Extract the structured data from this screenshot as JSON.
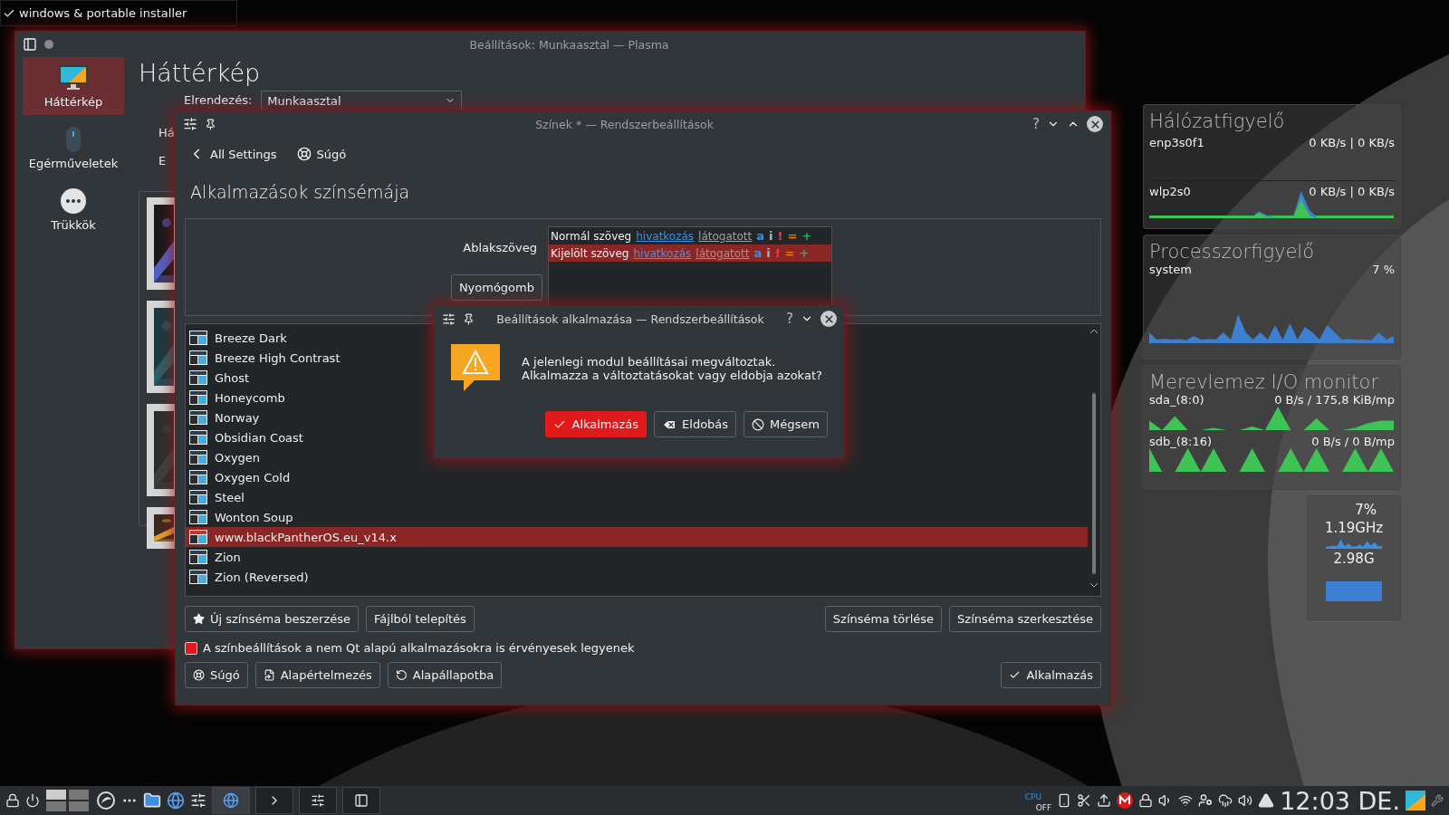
{
  "top_task": {
    "label": "windows & portable installer",
    "checked": true
  },
  "back_window": {
    "title": "Beállítások: Munkaasztal — Plasma",
    "heading": "Háttérkép",
    "layout_label": "Elrendezés:",
    "layout_value": "Munkaasztal",
    "cut_labels": [
      "Há",
      "E"
    ],
    "sidebar": [
      {
        "label": "Háttérkép",
        "selected": true,
        "kind": "monitor"
      },
      {
        "label": "Egérműveletek",
        "selected": false,
        "kind": "mouse"
      },
      {
        "label": "Trükkök",
        "selected": false,
        "kind": "dots"
      }
    ],
    "thumbnails": [
      {
        "kind": "picture"
      },
      {
        "kind": "picture"
      },
      {
        "kind": "picture"
      },
      {
        "kind": "picture"
      }
    ]
  },
  "settings_window": {
    "title": "Színek * — Rendszerbeállítások",
    "help": "?",
    "back": "All Settings",
    "help_link": "Súgó",
    "heading": "Alkalmazások színsémája",
    "preview": {
      "window_text": "Ablakszöveg",
      "button": "Nyomógomb",
      "rows": [
        {
          "selected": false,
          "label": "Normál szöveg",
          "link": "hivatkozás",
          "visited": "látogatott",
          "marks": [
            {
              "text": "a",
              "color": "#3d8ee0"
            },
            {
              "text": "i",
              "color": "#b0b4b8"
            },
            {
              "text": "!",
              "color": "#da4453"
            },
            {
              "text": "=",
              "color": "#f67400"
            },
            {
              "text": "+",
              "color": "#27ae60"
            }
          ]
        },
        {
          "selected": true,
          "label": "Kijelölt szöveg",
          "link": "hivatkozás",
          "visited": "látogatott",
          "marks": [
            {
              "text": "a",
              "color": "#3d8ee0"
            },
            {
              "text": "i",
              "color": "#b0b4b8"
            },
            {
              "text": "!",
              "color": "#ff3b3b"
            },
            {
              "text": "=",
              "color": "#f67400"
            },
            {
              "text": "+",
              "color": "#27ae60"
            }
          ]
        }
      ]
    },
    "schemes": [
      {
        "name": "Breeze Dark",
        "selected": false
      },
      {
        "name": "Breeze High Contrast",
        "selected": false
      },
      {
        "name": "Ghost",
        "selected": false
      },
      {
        "name": "Honeycomb",
        "selected": false
      },
      {
        "name": "Norway",
        "selected": false
      },
      {
        "name": "Obsidian Coast",
        "selected": false
      },
      {
        "name": "Oxygen",
        "selected": false
      },
      {
        "name": "Oxygen Cold",
        "selected": false
      },
      {
        "name": "Steel",
        "selected": false
      },
      {
        "name": "Wonton Soup",
        "selected": false
      },
      {
        "name": "www.blackPantherOS.eu_v14.x",
        "selected": true
      },
      {
        "name": "Zion",
        "selected": false
      },
      {
        "name": "Zion (Reversed)",
        "selected": false
      }
    ],
    "get_new": "Új színséma beszerzése",
    "install": "Fájlból telepítés",
    "remove": "Színséma törlése",
    "edit": "Színséma szerkesztése",
    "apply_non_qt": {
      "label": "A színbeállítások a nem Qt alapú alkalmazásokra is érvényesek legyenek",
      "checked": true
    },
    "footer": {
      "help": "Súgó",
      "defaults": "Alapértelmezés",
      "reset": "Alapállapotba",
      "apply": "Alkalmazás"
    }
  },
  "dialog": {
    "title": "Beállítások alkalmazása — Rendszerbeállítások",
    "help": "?",
    "message": "A jelenlegi modul beállításai megváltoztak.\nAlkalmazza a változtatásokat vagy eldobja azokat?",
    "buttons": [
      {
        "label": "Alkalmazás",
        "kind": "apply"
      },
      {
        "label": "Eldobás",
        "kind": "discard"
      },
      {
        "label": "Mégsem",
        "kind": "cancel"
      }
    ]
  },
  "network_monitor": {
    "title": "Hálózatfigyelő",
    "interfaces": [
      {
        "name": "enp3s0f1",
        "rate": "0 KB/s | 0 KB/s"
      },
      {
        "name": "wlp2s0",
        "rate": "0 KB/s | 0 KB/s"
      }
    ]
  },
  "cpu_monitor": {
    "title": "Processzorfigyelő",
    "name": "system",
    "value": "7 %"
  },
  "disk_monitor": {
    "title": "Merevlemez I/O monitor",
    "disks": [
      {
        "name": "sda_(8:0)",
        "rate": "0 B/s / 175,8 KiB/mp"
      },
      {
        "name": "sdb_(8:16)",
        "rate": "0 B/s / 0 B/mp"
      }
    ]
  },
  "system_load": {
    "cpu": "7%",
    "freq": "1.19GHz",
    "memory": "2.98G"
  },
  "taskbar": {
    "cpu_label": "CPU",
    "cpu_state": "OFF",
    "clock": "12:03 DE."
  }
}
